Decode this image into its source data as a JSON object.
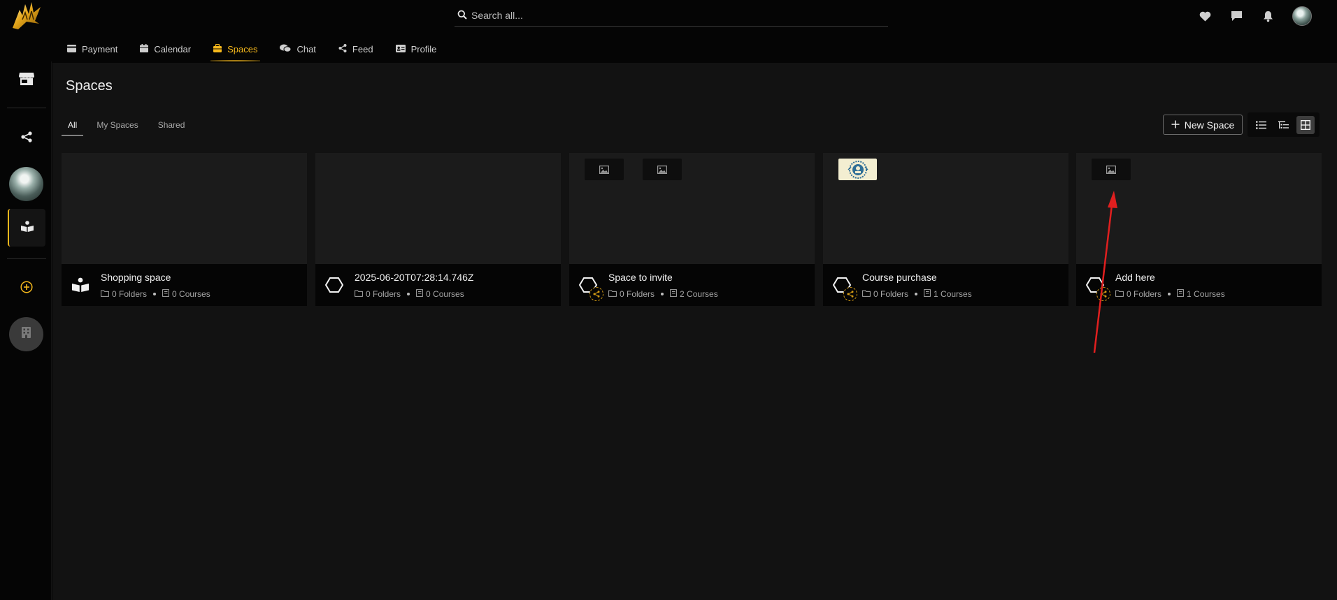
{
  "search": {
    "placeholder": "Search all..."
  },
  "nav": {
    "tabs": [
      {
        "label": "Payment",
        "icon": "credit-card-icon"
      },
      {
        "label": "Calendar",
        "icon": "calendar-icon"
      },
      {
        "label": "Spaces",
        "icon": "briefcase-icon",
        "active": true
      },
      {
        "label": "Chat",
        "icon": "chat-bubbles-icon"
      },
      {
        "label": "Feed",
        "icon": "share-nodes-icon"
      },
      {
        "label": "Profile",
        "icon": "id-card-icon"
      }
    ]
  },
  "topbar_icons": [
    "heart-icon",
    "message-icon",
    "bell-icon",
    "avatar"
  ],
  "sidebar": {
    "items": [
      "store-icon",
      "share-nodes-icon",
      "user-avatar",
      "reading-person-icon",
      "add-circle-icon",
      "building-icon"
    ]
  },
  "main": {
    "title": "Spaces",
    "subtabs": [
      {
        "label": "All",
        "active": true
      },
      {
        "label": "My Spaces"
      },
      {
        "label": "Shared"
      }
    ],
    "new_space_label": "New Space",
    "view_modes": [
      "list-view-icon",
      "tree-view-icon",
      "grid-view-icon"
    ],
    "active_view": "grid",
    "accent_color": "#f5b81c"
  },
  "cards": [
    {
      "name": "Shopping space",
      "folders": "0 Folders",
      "courses": "0 Courses",
      "icon": "reading-person-icon",
      "shared": false,
      "thumbs": []
    },
    {
      "name": "2025-06-20T07:28:14.746Z",
      "folders": "0 Folders",
      "courses": "0 Courses",
      "icon": "hexagon-icon",
      "shared": false,
      "thumbs": []
    },
    {
      "name": "Space to invite",
      "folders": "0 Folders",
      "courses": "2 Courses",
      "icon": "hexagon-icon",
      "shared": true,
      "thumbs": [
        "image-placeholder-icon",
        "image-placeholder-icon"
      ]
    },
    {
      "name": "Course purchase",
      "folders": "0 Folders",
      "courses": "1 Courses",
      "icon": "hexagon-icon",
      "shared": true,
      "thumbs": [
        "course-logo-image"
      ]
    },
    {
      "name": "Add here",
      "folders": "0 Folders",
      "courses": "1 Courses",
      "icon": "hexagon-icon",
      "shared": true,
      "thumbs": [
        "image-placeholder-icon"
      ]
    }
  ]
}
